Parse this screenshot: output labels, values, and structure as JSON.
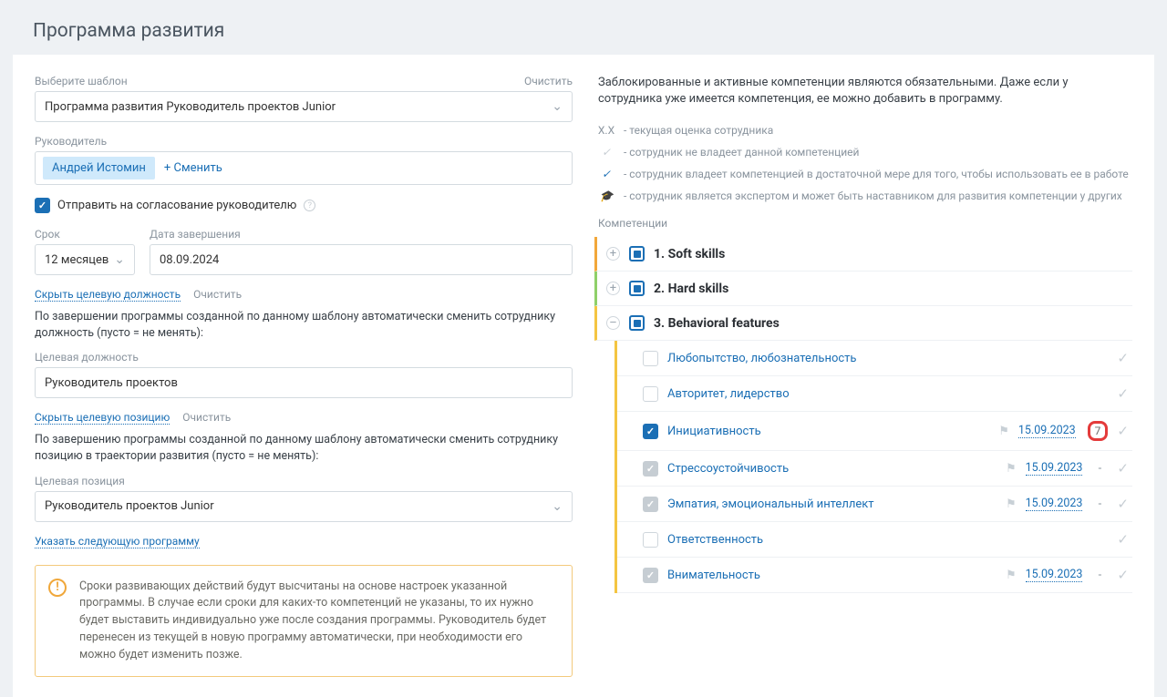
{
  "page_title": "Программа развития",
  "left": {
    "template_label": "Выберите шаблон",
    "clear": "Очистить",
    "template_value": "Программа развития Руководитель проектов Junior",
    "manager_label": "Руководитель",
    "manager_name": "Андрей Истомин",
    "change": "Сменить",
    "send_for_approval": "Отправить на согласование руководителю",
    "term_label": "Срок",
    "term_value": "12 месяцев",
    "end_date_label": "Дата завершения",
    "end_date_value": "08.09.2024",
    "hide_target_position": "Скрыть целевую должность",
    "target_position_explain": "По завершении программы созданной по данному шаблону автоматически сменить сотруднику должность (пусто = не менять):",
    "target_position_label": "Целевая должность",
    "target_position_value": "Руководитель проектов",
    "hide_target_slot": "Скрыть целевую позицию",
    "target_slot_explain": "По завершению программы созданной по данному шаблону автоматически сменить сотруднику позицию в траектории развития (пусто = не менять):",
    "target_slot_label": "Целевая позиция",
    "target_slot_value": "Руководитель проектов Junior",
    "next_program": "Указать следующую программу",
    "warn_text": "Сроки развивающих действий будут высчитаны на основе настроек указанной программы. В случае если сроки для каких-то компетенций не указаны, то их нужно будет выставить индивидуально уже после создания программы. Руководитель будет перенесен из текущей в новую программу автоматически, при необходимости его можно будет изменить позже."
  },
  "right": {
    "intro": "Заблокированные и активные компетенции являются обязательными. Даже если у сотрудника уже имеется компетенция, ее можно добавить в программу.",
    "legend": {
      "xx_key": "Х.Х",
      "xx": "- текущая оценка сотрудника",
      "none": "- сотрудник не владеет данной компетенцией",
      "has": "- сотрудник владеет компетенцией в достаточной мере для того, чтобы использовать ее в работе",
      "expert": "- сотрудник является экспертом и может быть наставником для развития компетенции у других"
    },
    "competencies_label": "Компетенции",
    "groups": [
      {
        "title": "1. Soft skills",
        "expanded": false,
        "color": "orange"
      },
      {
        "title": "2. Hard skills",
        "expanded": false,
        "color": "green"
      },
      {
        "title": "3. Behavioral features",
        "expanded": true,
        "color": "yellow"
      }
    ],
    "behavioral_items": [
      {
        "name": "Любопытство, любознательность",
        "checkbox": "empty",
        "flag": false,
        "date": "",
        "score": ""
      },
      {
        "name": "Авторитет, лидерство",
        "checkbox": "empty",
        "flag": false,
        "date": "",
        "score": ""
      },
      {
        "name": "Инициативность",
        "checkbox": "checked",
        "flag": true,
        "date": "15.09.2023",
        "score": "7",
        "highlight": true
      },
      {
        "name": "Стрессоустойчивость",
        "checkbox": "grey",
        "flag": true,
        "date": "15.09.2023",
        "score": "-"
      },
      {
        "name": "Эмпатия, эмоциональный интеллект",
        "checkbox": "grey",
        "flag": true,
        "date": "15.09.2023",
        "score": "-"
      },
      {
        "name": "Ответственность",
        "checkbox": "empty",
        "flag": false,
        "date": "",
        "score": ""
      },
      {
        "name": "Внимательность",
        "checkbox": "grey",
        "flag": true,
        "date": "15.09.2023",
        "score": "-"
      }
    ]
  }
}
